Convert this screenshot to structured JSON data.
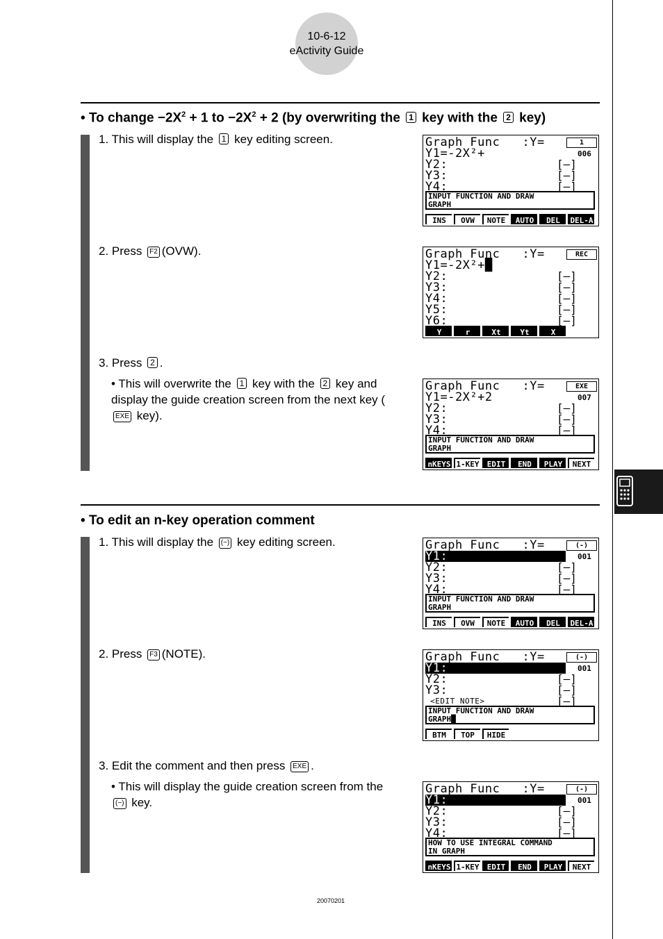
{
  "header": {
    "page_number": "10-6-12",
    "section": "eActivity Guide"
  },
  "footer": {
    "code": "20070201"
  },
  "side_tab": {
    "icon": "calculator-icon"
  },
  "sections": [
    {
      "heading": {
        "pre": "To change −2X",
        "sup1": "2",
        "mid": " + 1 to −2X",
        "sup2": "2",
        "mid2": " + 2 (by overwriting the ",
        "key1": "1",
        "mid3": " key with the ",
        "key2": "2",
        "post": " key)"
      },
      "steps": [
        {
          "pre": "1. This will display the ",
          "key": "1",
          "post": " key editing screen."
        },
        {
          "pre": "2. Press ",
          "key": "F2",
          "post": "(OVW)."
        },
        {
          "pre": "3. Press ",
          "key": "2",
          "post": "."
        }
      ],
      "bullet": {
        "pre": "This will overwrite the ",
        "key1": "1",
        "mid": " key with the ",
        "key2": "2",
        "post": " key and display the guide creation screen from the next key (",
        "key3": "EXE",
        "post2": " key)."
      }
    },
    {
      "heading": {
        "text": "To edit an n-key operation comment"
      },
      "steps": [
        {
          "pre": "1. This will display the ",
          "key": "(−)",
          "post": " key editing screen."
        },
        {
          "pre": "2. Press ",
          "key": "F3",
          "post": "(NOTE)."
        },
        {
          "pre": "3. Edit the comment and then press ",
          "key": "EXE",
          "post": "."
        }
      ],
      "bullet": {
        "pre": "This will display the guide creation screen from the ",
        "key": "(−)",
        "post": " key."
      }
    }
  ],
  "screens": [
    {
      "title": "Graph Func   :Y=",
      "key": "1",
      "counter": "006",
      "rows": [
        {
          "t": "Y1=-2X²+",
          "b": false,
          "hl": false
        },
        {
          "t": "Y2:",
          "b": true
        },
        {
          "t": "Y3:",
          "b": true
        },
        {
          "t": "Y4:",
          "b": true
        }
      ],
      "message": "INPUT FUNCTION AND DRAW\nGRAPH",
      "fkeys": [
        {
          "l": "INS",
          "inv": false
        },
        {
          "l": "OVW",
          "inv": false
        },
        {
          "l": "NOTE",
          "inv": false
        },
        {
          "l": "AUTO",
          "inv": true
        },
        {
          "l": "DEL",
          "inv": true
        },
        {
          "l": "DEL-A",
          "inv": true
        }
      ]
    },
    {
      "title": "Graph Func   :Y=",
      "key": "REC",
      "counter": "",
      "rows": [
        {
          "t": "Y1=-2X²+█",
          "b": false
        },
        {
          "t": "Y2:",
          "b": true
        },
        {
          "t": "Y3:",
          "b": true
        },
        {
          "t": "Y4:",
          "b": true
        },
        {
          "t": "Y5:",
          "b": true
        },
        {
          "t": "Y6:",
          "b": true
        }
      ],
      "message": "",
      "fkeys": [
        {
          "l": "Y",
          "inv": true
        },
        {
          "l": "r",
          "inv": true
        },
        {
          "l": "Xt",
          "inv": true
        },
        {
          "l": "Yt",
          "inv": true
        },
        {
          "l": "X",
          "inv": true
        }
      ]
    },
    {
      "title": "Graph Func   :Y=",
      "key": "EXE",
      "counter": "007",
      "rows": [
        {
          "t": "Y1=-2X²+2",
          "b": false
        },
        {
          "t": "Y2:",
          "b": true
        },
        {
          "t": "Y3:",
          "b": true
        },
        {
          "t": "Y4:",
          "b": true
        }
      ],
      "message": "INPUT FUNCTION AND DRAW\nGRAPH",
      "fkeys": [
        {
          "l": "nKEYS",
          "inv": true
        },
        {
          "l": "1-KEY",
          "inv": false
        },
        {
          "l": "EDIT",
          "inv": true
        },
        {
          "l": "END",
          "inv": true
        },
        {
          "l": "PLAY",
          "inv": true
        },
        {
          "l": "NEXT",
          "inv": false
        }
      ]
    },
    {
      "title": "Graph Func   :Y=",
      "key": "(-)",
      "counter": "001",
      "rows": [
        {
          "t": "Y1:",
          "b": false,
          "hl": true
        },
        {
          "t": "Y2:",
          "b": true
        },
        {
          "t": "Y3:",
          "b": true
        },
        {
          "t": "Y4:",
          "b": true
        }
      ],
      "message": "INPUT FUNCTION AND DRAW\nGRAPH",
      "fkeys": [
        {
          "l": "INS",
          "inv": false
        },
        {
          "l": "OVW",
          "inv": false
        },
        {
          "l": "NOTE",
          "inv": false
        },
        {
          "l": "AUTO",
          "inv": true
        },
        {
          "l": "DEL",
          "inv": true
        },
        {
          "l": "DEL-A",
          "inv": true
        }
      ]
    },
    {
      "title": "Graph Func   :Y=",
      "key": "(-)",
      "counter": "001",
      "rows": [
        {
          "t": "Y1:",
          "b": false,
          "hl": true
        },
        {
          "t": "Y2:",
          "b": true
        },
        {
          "t": "Y3:",
          "b": true
        },
        {
          "t": " <EDIT NOTE>",
          "b": true,
          "small": true
        }
      ],
      "message": "INPUT FUNCTION AND DRAW\nGRAPH█",
      "fkeys": [
        {
          "l": "BTM",
          "inv": false
        },
        {
          "l": "TOP",
          "inv": false
        },
        {
          "l": "HIDE",
          "inv": false
        }
      ]
    },
    {
      "title": "Graph Func   :Y=",
      "key": "(-)",
      "counter": "001",
      "rows": [
        {
          "t": "Y1:",
          "b": false,
          "hl": true
        },
        {
          "t": "Y2:",
          "b": true
        },
        {
          "t": "Y3:",
          "b": true
        },
        {
          "t": "Y4:",
          "b": true
        }
      ],
      "message": "HOW TO USE INTEGRAL COMMAND\nIN GRAPH",
      "fkeys": [
        {
          "l": "nKEYS",
          "inv": true
        },
        {
          "l": "1-KEY",
          "inv": false
        },
        {
          "l": "EDIT",
          "inv": true
        },
        {
          "l": "END",
          "inv": true
        },
        {
          "l": "PLAY",
          "inv": true
        },
        {
          "l": "NEXT",
          "inv": false
        }
      ]
    }
  ]
}
